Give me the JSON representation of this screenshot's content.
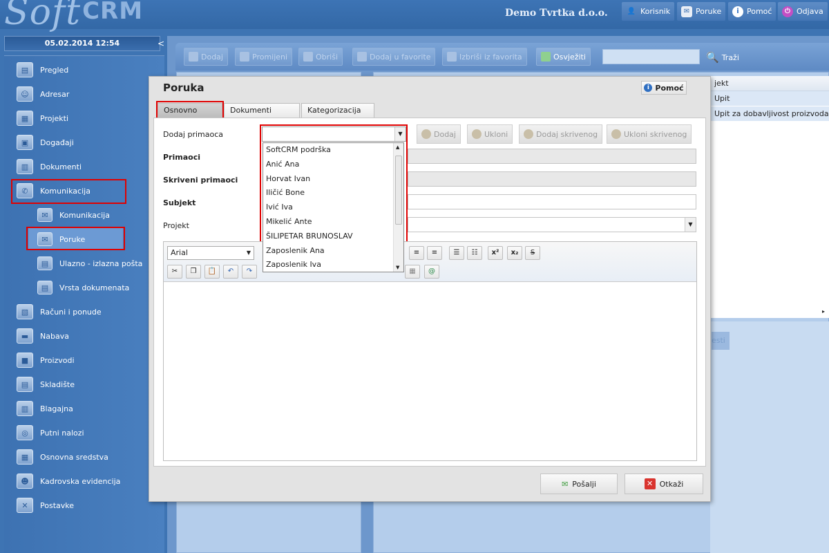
{
  "app": {
    "logo_soft": "Soft",
    "logo_crm": "CRM",
    "company": "Demo Tvrtka d.o.o.",
    "datetime": "05.02.2014 12:54"
  },
  "topnav": [
    {
      "label": "Korisnik",
      "icon": "user-icon"
    },
    {
      "label": "Poruke",
      "icon": "messages-icon"
    },
    {
      "label": "Pomoć",
      "icon": "help-icon"
    },
    {
      "label": "Odjava",
      "icon": "power-icon"
    }
  ],
  "sidebar": {
    "items": [
      {
        "label": "Pregled",
        "icon": "overview-icon"
      },
      {
        "label": "Adresar",
        "icon": "address-book-icon"
      },
      {
        "label": "Projekti",
        "icon": "projects-icon"
      },
      {
        "label": "Događaji",
        "icon": "calendar-icon"
      },
      {
        "label": "Dokumenti",
        "icon": "documents-icon"
      },
      {
        "label": "Komunikacija",
        "icon": "communication-icon"
      },
      {
        "label": "Komunikacija",
        "icon": "communication-sub-icon"
      },
      {
        "label": "Poruke",
        "icon": "envelope-icon"
      },
      {
        "label": "Ulazno - izlazna pošta",
        "icon": "mail-log-icon"
      },
      {
        "label": "Vrsta dokumenata",
        "icon": "document-type-icon"
      },
      {
        "label": "Računi i ponude",
        "icon": "invoice-icon"
      },
      {
        "label": "Nabava",
        "icon": "procurement-icon"
      },
      {
        "label": "Proizvodi",
        "icon": "products-icon"
      },
      {
        "label": "Skladište",
        "icon": "warehouse-icon"
      },
      {
        "label": "Blagajna",
        "icon": "cash-register-icon"
      },
      {
        "label": "Putni nalozi",
        "icon": "travel-icon"
      },
      {
        "label": "Osnovna sredstva",
        "icon": "assets-icon"
      },
      {
        "label": "Kadrovska evidencija",
        "icon": "hr-icon"
      },
      {
        "label": "Postavke",
        "icon": "settings-icon"
      }
    ]
  },
  "toolbar": {
    "dodaj": "Dodaj",
    "promijeni": "Promijeni",
    "obrisi": "Obriši",
    "dodaj_fav": "Dodaj u favorite",
    "izbrisi_fav": "Izbriši iz favorita",
    "osvjeziti": "Osvježiti",
    "search_value": "",
    "trazi": "Traži"
  },
  "grid": {
    "header": "jekt",
    "rows": [
      "Upit",
      "Upit za dobavljivost proizvoda"
    ],
    "lower_btn": "esti"
  },
  "dialog": {
    "title": "Poruka",
    "help": "Pomoć",
    "tabs": [
      "Osnovno",
      "Dokumenti",
      "Kategorizacija"
    ],
    "fields": {
      "dodaj_primaoca": "Dodaj primaoca",
      "primaoci": "Primaoci",
      "skriveni": "Skriveni primaoci",
      "subjekt": "Subjekt",
      "projekt": "Projekt"
    },
    "recipient_value": "",
    "buttons": {
      "dodaj": "Dodaj",
      "ukloni": "Ukloni",
      "dodaj_skrivenog": "Dodaj skrivenog",
      "ukloni_skrivenog": "Ukloni skrivenog"
    },
    "dropdown": [
      "SoftCRM podrška",
      "Anić Ana",
      "Horvat Ivan",
      "Iličić  Bone",
      "Ivić Iva",
      "Mikelić Ante",
      "ŠILIPETAR BRUNOSLAV",
      "Zaposlenik Ana",
      "Zaposlenik Iva"
    ],
    "editor": {
      "font": "Arial",
      "body": ""
    },
    "footer": {
      "send": "Pošalji",
      "cancel": "Otkaži"
    }
  },
  "colors": {
    "highlight": "#e00000",
    "accent": "#3e74b3"
  }
}
